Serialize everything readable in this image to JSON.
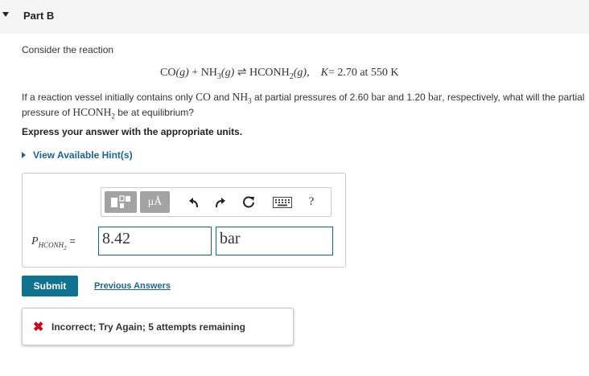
{
  "part": {
    "title": "Part B"
  },
  "prompt": {
    "intro": "Consider the reaction",
    "equation": {
      "lhs1": "CO",
      "lhs1_phase": "(g)",
      "plus": "+",
      "lhs2": "NH",
      "lhs2_sub": "3",
      "lhs2_phase": "(g)",
      "arrow": "⇌",
      "rhs": "HCONH",
      "rhs_sub": "2",
      "rhs_phase": "(g),",
      "k_label": "K",
      "k_value": "= 2.70 at 550 K"
    },
    "question": {
      "p1": "If a reaction vessel initially contains only",
      "co": "CO",
      "and1": "and",
      "nh": "NH",
      "nh_sub": "3",
      "p2": "at partial pressures of 2.60",
      "unit1": "bar",
      "and2": "and 1.20",
      "unit2": "bar",
      "p3": ", respectively, what will the partial pressure of",
      "hconh": "HCONH",
      "hconh_sub": "2",
      "p4": "be at equilibrium?"
    },
    "instruction": "Express your answer with the appropriate units.",
    "hint_link": "View Available Hint(s)"
  },
  "toolbar": {
    "units_label": "μÅ",
    "help_label": "?",
    "icons": [
      "templates-icon",
      "units-icon",
      "undo-icon",
      "redo-icon",
      "reset-icon",
      "keyboard-icon",
      "help-icon"
    ]
  },
  "answer": {
    "var_symbol": "P",
    "var_sub": "HCONH",
    "var_sub2": "2",
    "equals": "=",
    "value": "8.42",
    "unit": "bar"
  },
  "actions": {
    "submit_label": "Submit",
    "previous_answers_label": "Previous Answers"
  },
  "feedback": {
    "message": "Incorrect; Try Again; 5 attempts remaining",
    "status_color": "#d0021b"
  },
  "colors": {
    "accent": "#0e7290",
    "link": "#1a6496",
    "header_bg": "#f5f5f5"
  }
}
